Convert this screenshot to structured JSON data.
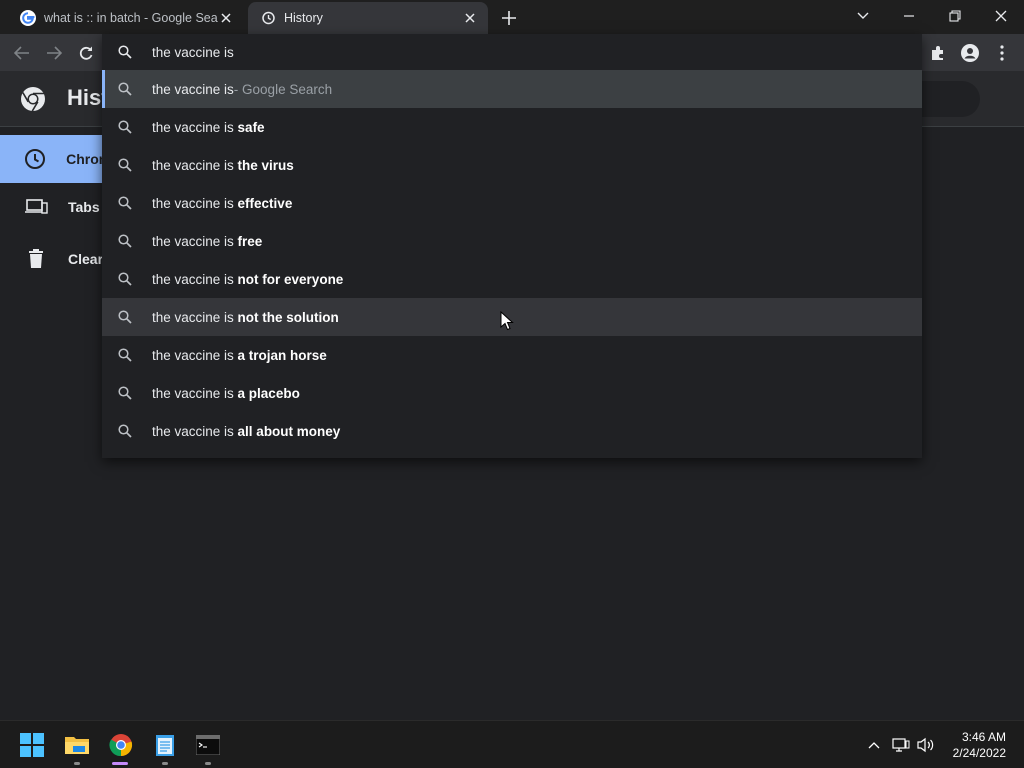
{
  "tabs": [
    {
      "title": "what is :: in batch - Google Searc",
      "icon": "google-icon",
      "active": false
    },
    {
      "title": "History",
      "icon": "history-icon",
      "active": true
    }
  ],
  "page": {
    "title": "Hist",
    "sidebar": [
      {
        "label": "Chron",
        "icon": "clock-icon",
        "active": true
      },
      {
        "label": "Tabs",
        "icon": "devices-icon",
        "active": false
      },
      {
        "label": "Clear",
        "icon": "trash-icon",
        "active": false
      }
    ]
  },
  "omnibox": {
    "query": "the vaccine is",
    "suggestions": [
      {
        "prefix": "the vaccine is",
        "bold": "",
        "suffix": " - Google Search"
      },
      {
        "prefix": "the vaccine is ",
        "bold": "safe",
        "suffix": ""
      },
      {
        "prefix": "the vaccine is ",
        "bold": "the virus",
        "suffix": ""
      },
      {
        "prefix": "the vaccine is ",
        "bold": "effective",
        "suffix": ""
      },
      {
        "prefix": "the vaccine is ",
        "bold": "free",
        "suffix": ""
      },
      {
        "prefix": "the vaccine is ",
        "bold": "not for everyone",
        "suffix": ""
      },
      {
        "prefix": "the vaccine is ",
        "bold": "not the solution",
        "suffix": ""
      },
      {
        "prefix": "the vaccine is ",
        "bold": "a trojan horse",
        "suffix": ""
      },
      {
        "prefix": "the vaccine is ",
        "bold": "a placebo",
        "suffix": ""
      },
      {
        "prefix": "the vaccine is ",
        "bold": "all about money",
        "suffix": ""
      }
    ]
  },
  "taskbar": {
    "apps": [
      "windows-start-icon",
      "file-explorer-icon",
      "chrome-icon",
      "notepad-icon",
      "terminal-icon"
    ],
    "time": "3:46 AM",
    "date": "2/24/2022"
  },
  "colors": {
    "accent": "#8ab4f8",
    "background": "#202124"
  }
}
